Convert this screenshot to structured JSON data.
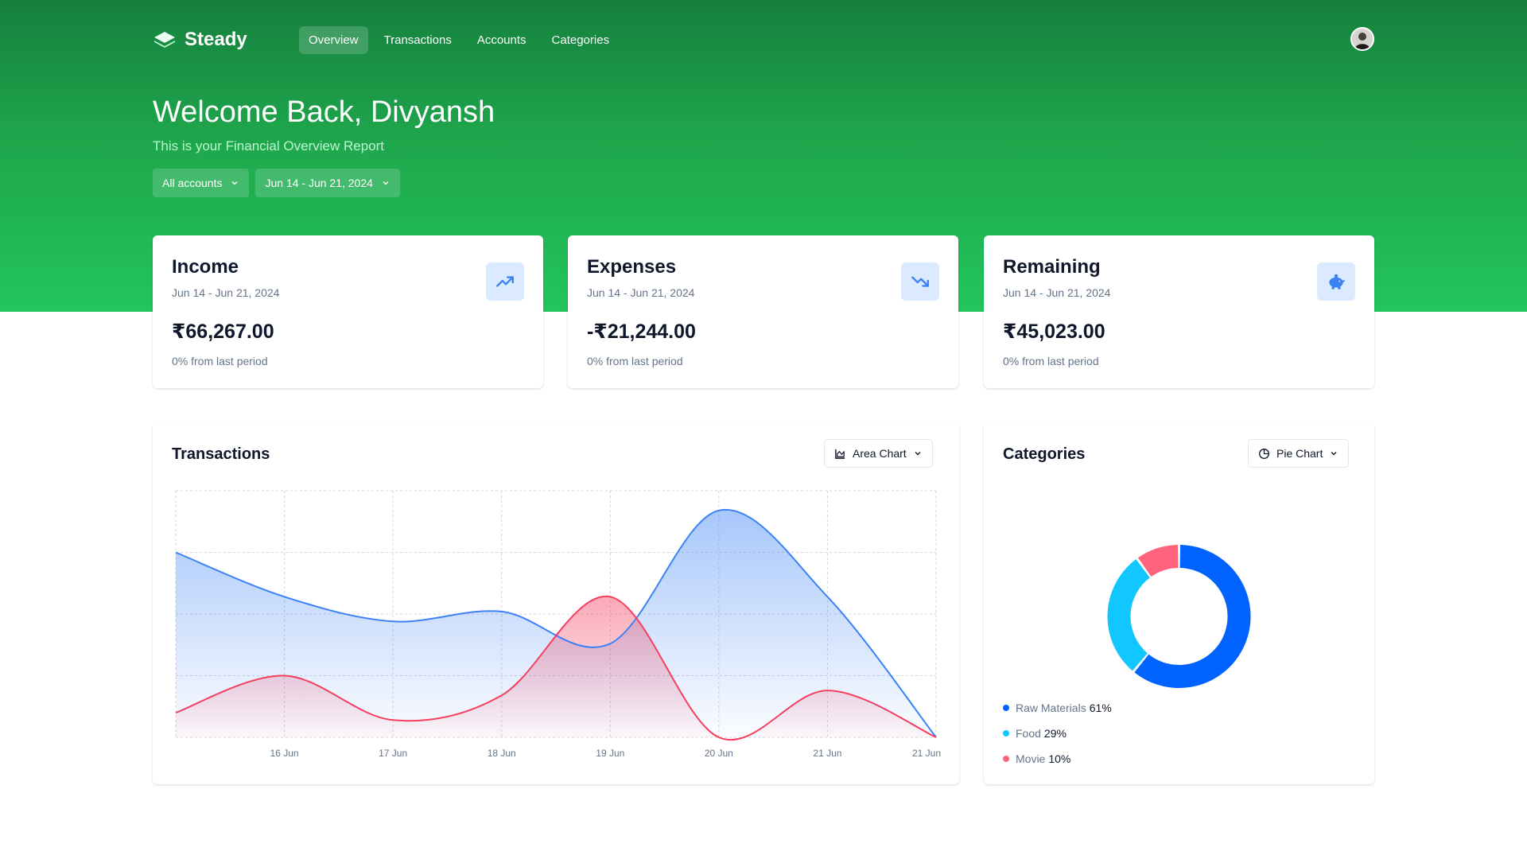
{
  "app": {
    "name": "Steady"
  },
  "nav": {
    "links": [
      "Overview",
      "Transactions",
      "Accounts",
      "Categories"
    ],
    "active": "Overview"
  },
  "header": {
    "welcome": "Welcome Back, Divyansh",
    "subtitle": "This is your Financial Overview Report"
  },
  "filters": {
    "account": "All accounts",
    "date_range": "Jun 14 - Jun 21, 2024"
  },
  "stats": [
    {
      "title": "Income",
      "range": "Jun 14 - Jun 21, 2024",
      "value": "₹66,267.00",
      "note": "0% from last period",
      "icon": "trending-up-icon"
    },
    {
      "title": "Expenses",
      "range": "Jun 14 - Jun 21, 2024",
      "value": "-₹21,244.00",
      "note": "0% from last period",
      "icon": "trending-down-icon"
    },
    {
      "title": "Remaining",
      "range": "Jun 14 - Jun 21, 2024",
      "value": "₹45,023.00",
      "note": "0% from last period",
      "icon": "piggy-bank-icon"
    }
  ],
  "transactions_panel": {
    "title": "Transactions",
    "chart_selector": "Area Chart"
  },
  "categories_panel": {
    "title": "Categories",
    "chart_selector": "Pie Chart"
  },
  "colors": {
    "income": "#3b82f6",
    "expenses": "#f43f5e",
    "accent_green": "#22c55e",
    "icon_bg": "#dbeafe"
  },
  "chart_data": [
    {
      "type": "area",
      "title": "",
      "x": [
        "",
        "16 Jun",
        "17 Jun",
        "18 Jun",
        "19 Jun",
        "20 Jun",
        "21 Jun",
        "21 Jun"
      ],
      "ylim": [
        0,
        100
      ],
      "grid": true,
      "series": [
        {
          "values": [
            75,
            57,
            47,
            51,
            38,
            92,
            57,
            0
          ]
        },
        {
          "values": [
            10,
            25,
            7,
            17,
            57,
            0,
            19,
            0
          ]
        }
      ]
    },
    {
      "type": "pie",
      "title": "",
      "donut": true,
      "slices": [
        {
          "label": "Raw Materials",
          "value": 61,
          "display": "61%",
          "color": "#0062ff"
        },
        {
          "label": "Food",
          "value": 29,
          "display": "29%",
          "color": "#12c6ff"
        },
        {
          "label": "Movie",
          "value": 10,
          "display": "10%",
          "color": "#ff647f"
        }
      ],
      "legend_position": "bottom-left"
    }
  ]
}
